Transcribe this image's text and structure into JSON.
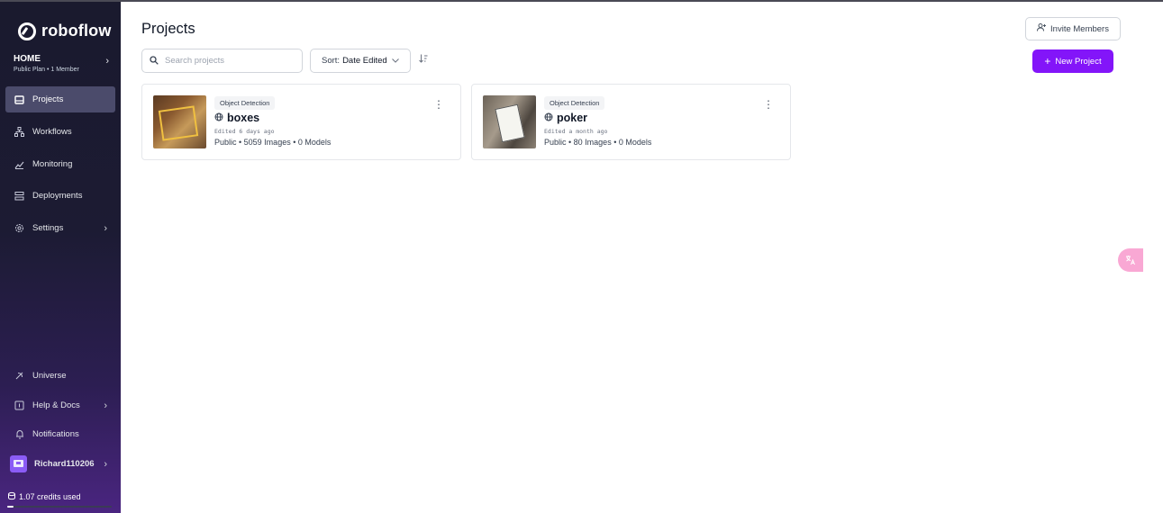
{
  "brand": {
    "name": "roboflow"
  },
  "workspace": {
    "name": "HOME",
    "plan": "Public Plan • 1 Member"
  },
  "sidebar": {
    "items": [
      {
        "label": "Projects",
        "icon": "projects-icon"
      },
      {
        "label": "Workflows",
        "icon": "workflows-icon"
      },
      {
        "label": "Monitoring",
        "icon": "monitoring-icon"
      },
      {
        "label": "Deployments",
        "icon": "deployments-icon"
      },
      {
        "label": "Settings",
        "icon": "settings-icon"
      }
    ],
    "bottom_items": [
      {
        "label": "Universe",
        "icon": "universe-icon"
      },
      {
        "label": "Help & Docs",
        "icon": "help-icon"
      },
      {
        "label": "Notifications",
        "icon": "bell-icon"
      }
    ],
    "user": {
      "name": "Richard110206"
    },
    "credits": {
      "label": "1.07 credits used",
      "fraction": 0.06
    }
  },
  "header": {
    "title": "Projects",
    "invite_label": "Invite Members",
    "new_project_label": "New Project"
  },
  "toolbar": {
    "search_placeholder": "Search projects",
    "sort_prefix": "Sort:",
    "sort_value": "Date Edited"
  },
  "projects": [
    {
      "type": "Object Detection",
      "name": "boxes",
      "edited": "Edited 6 days ago",
      "stats": "Public • 5059 Images • 0 Models"
    },
    {
      "type": "Object Detection",
      "name": "poker",
      "edited": "Edited a month ago",
      "stats": "Public • 80 Images • 0 Models"
    }
  ],
  "colors": {
    "accent": "#8315f9",
    "sidebar_active": "#4b4b6b"
  }
}
